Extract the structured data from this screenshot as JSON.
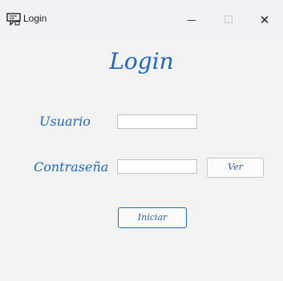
{
  "window": {
    "title": "Login",
    "controls": {
      "minimize": "—",
      "maximize": "☐",
      "close": "✕"
    }
  },
  "form": {
    "heading": "Login",
    "username_label": "Usuario",
    "username_value": "",
    "password_label": "Contraseña",
    "password_value": "",
    "show_button": "Ver",
    "submit_button": "Iniciar"
  },
  "colors": {
    "accent": "#1f66c4",
    "background": "#f3f3f3",
    "titlebar": "#f3f1f6"
  },
  "icons": {
    "app": "login-window-icon"
  }
}
